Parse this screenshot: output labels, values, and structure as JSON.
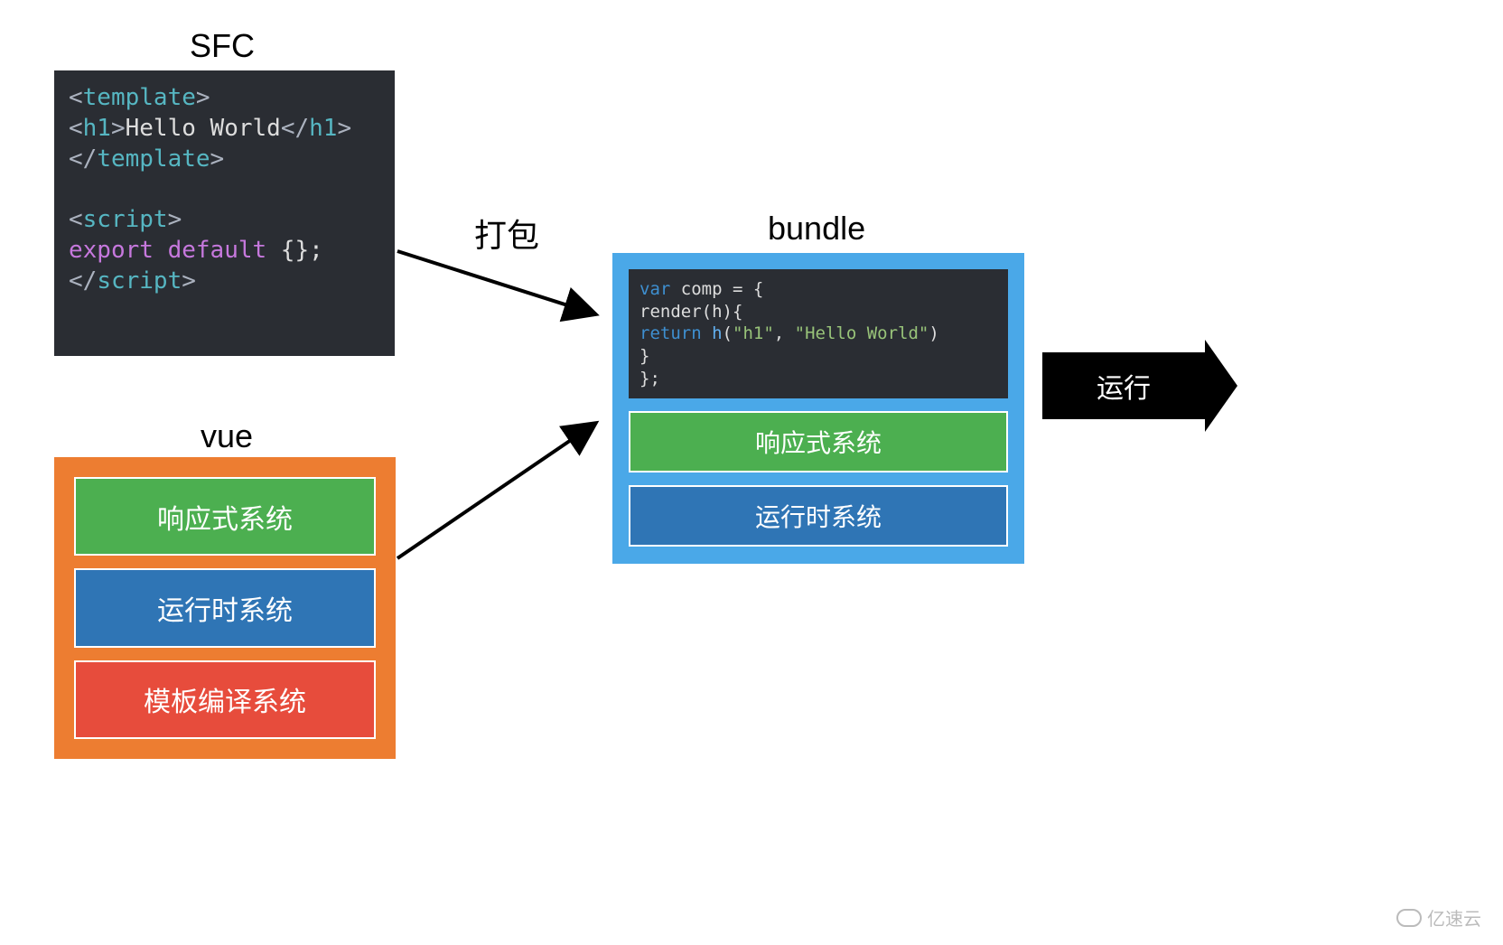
{
  "labels": {
    "sfc": "SFC",
    "vue": "vue",
    "bundle": "bundle",
    "pack": "打包",
    "run": "运行"
  },
  "sfc_code": {
    "line1_open": "<",
    "line1_tag": "template",
    "line1_close": ">",
    "line2_indent": "  ",
    "line2_open": "<",
    "line2_tag": "h1",
    "line2_close1": ">",
    "line2_text": "Hello World",
    "line2_open2": "</",
    "line2_close2": ">",
    "line3_open": "</",
    "line3_tag": "template",
    "line3_close": ">",
    "line5_open": "<",
    "line5_tag": "script",
    "line5_close": ">",
    "line6_export": "export",
    "line6_default": "default",
    "line6_rest": " {};",
    "line7_open": "</",
    "line7_tag": "script",
    "line7_close": ">"
  },
  "vue_items": {
    "reactive": "响应式系统",
    "runtime": "运行时系统",
    "compiler": "模板编译系统"
  },
  "bundle_code": {
    "l1_var": "var",
    "l1_rest": " comp = {",
    "l2": "  render(h){",
    "l3_indent": "    ",
    "l3_return": "return",
    "l3_sp": " ",
    "l3_h": "h",
    "l3_p1": "(",
    "l3_s1": "\"h1\"",
    "l3_c": ", ",
    "l3_s2": "\"Hello World\"",
    "l3_p2": ")",
    "l4": "  }",
    "l5": "};"
  },
  "bundle_items": {
    "reactive": "响应式系统",
    "runtime": "运行时系统"
  },
  "watermark": "亿速云"
}
